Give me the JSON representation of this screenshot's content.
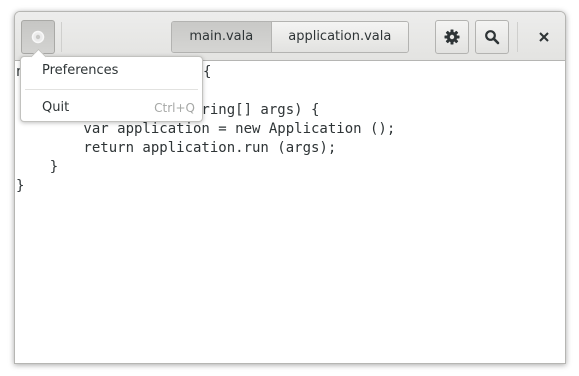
{
  "tabs": [
    {
      "label": "main.vala",
      "active": true
    },
    {
      "label": "application.vala",
      "active": false
    }
  ],
  "header": {
    "app_menu_icon": "app-menu-icon",
    "settings_icon": "gear-icon",
    "search_icon": "search-icon",
    "close_label": "×"
  },
  "menu": {
    "items": [
      {
        "label": "Preferences",
        "shortcut": ""
      },
      {
        "label": "Quit",
        "shortcut": "Ctrl+Q"
      }
    ]
  },
  "editor": {
    "lines": [
      "n",
      "",
      "           nt main (string[] args) {",
      "        var application = new Application ();",
      "        return application.run (args);",
      "    }",
      "}"
    ],
    "hidden_fragment": "{"
  },
  "colors": {
    "text": "#2e3436",
    "accelerator": "#a6a8a6",
    "header_bg": "#e3e3e1"
  }
}
